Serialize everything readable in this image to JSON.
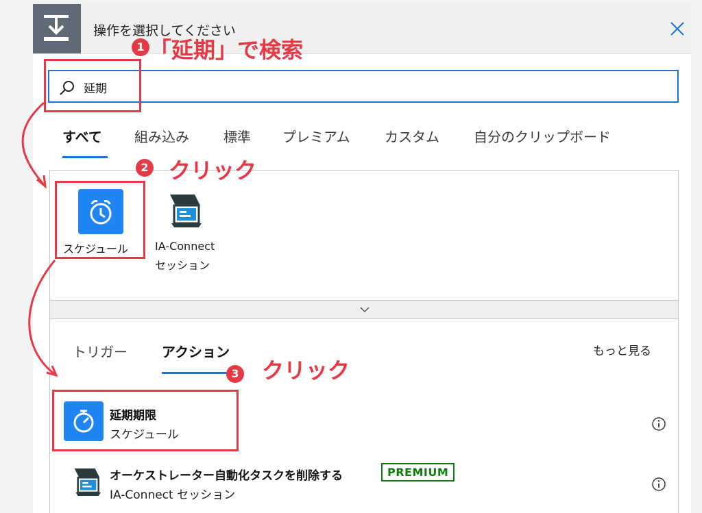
{
  "header": {
    "title": "操作を選択してください"
  },
  "search": {
    "value": "延期"
  },
  "tabs": [
    "すべて",
    "組み込み",
    "標準",
    "プレミアム",
    "カスタム",
    "自分のクリップボード"
  ],
  "connectors": [
    {
      "label_lines": [
        "スケジュール"
      ],
      "icon": "alarm-clock-icon",
      "color": "#1f85f2"
    },
    {
      "label_lines": [
        "IA-Connect",
        "セッション"
      ],
      "icon": "ia-connect-icon"
    }
  ],
  "subtabs": [
    "トリガー",
    "アクション"
  ],
  "see_more": "もっと見る",
  "actions": [
    {
      "title": "延期期限",
      "subtitle": "スケジュール",
      "icon": "timer-icon"
    },
    {
      "title": "オーケストレーター自動化タスクを削除する",
      "subtitle": "IA-Connect セッション",
      "badge": "PREMIUM",
      "icon": "ia-connect-icon"
    }
  ],
  "annotations": {
    "step1": {
      "num": "1",
      "text": "「延期」で検索"
    },
    "step2": {
      "num": "2",
      "text": "クリック"
    },
    "step3": {
      "num": "3",
      "text": "クリック"
    }
  },
  "colors": {
    "accent": "#1a73d9",
    "annotation": "#e63946",
    "premium": "#107c10"
  }
}
